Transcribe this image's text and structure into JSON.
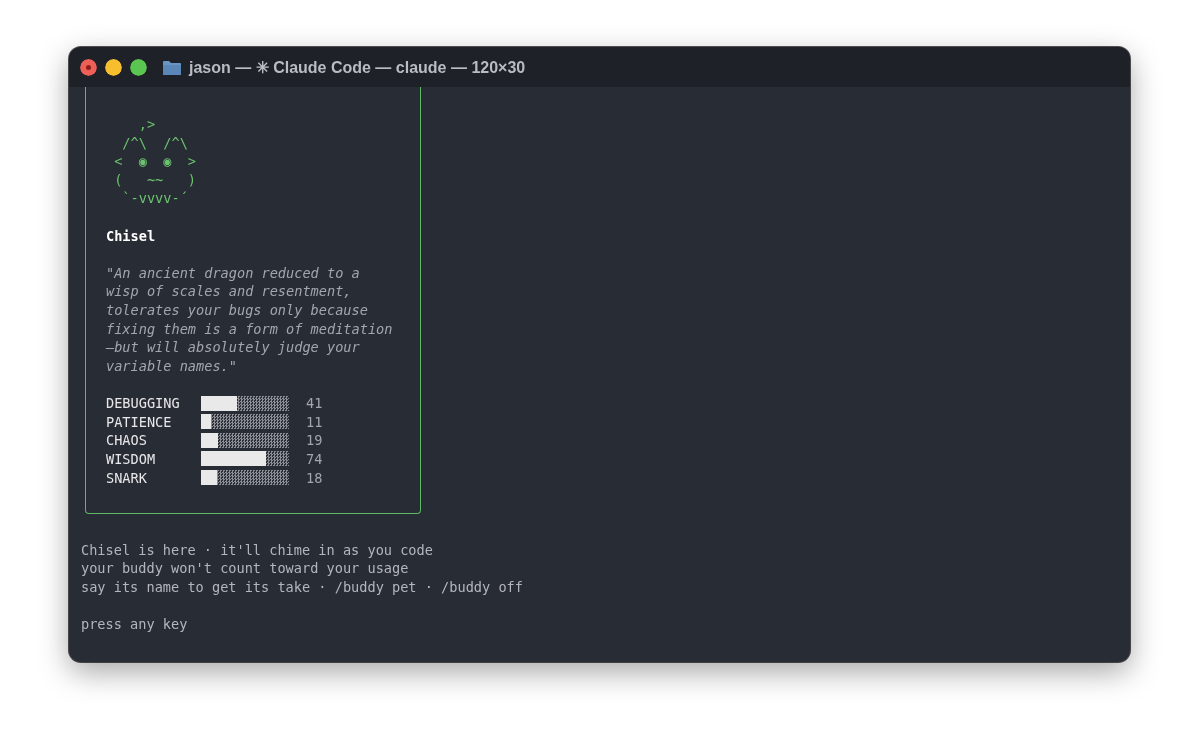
{
  "window": {
    "title": "jason — ✳ Claude Code — claude — 120×30"
  },
  "buddy": {
    "art": [
      "    ,>",
      "  /^\\  /^\\",
      " <  ◉  ◉  >",
      " (   ~~   )",
      "  `-vvvv-´"
    ],
    "name": "Chisel",
    "description": "\"An ancient dragon reduced to a wisp of scales and resentment, tolerates your bugs only because fixing them is a form of meditation—but will absolutely judge your variable names.\"",
    "stats": [
      {
        "label": "DEBUGGING",
        "level": 0.41,
        "value": "41"
      },
      {
        "label": "PATIENCE",
        "level": 0.11,
        "value": "11"
      },
      {
        "label": "CHAOS",
        "level": 0.19,
        "value": "19"
      },
      {
        "label": "WISDOM",
        "level": 0.74,
        "value": "74"
      },
      {
        "label": "SNARK",
        "level": 0.18,
        "value": "18"
      }
    ]
  },
  "messages": [
    "Chisel is here · it'll chime in as you code",
    "your buddy won't count toward your usage",
    "say its name to get its take · /buddy pet · /buddy off"
  ],
  "prompt": "press any key"
}
